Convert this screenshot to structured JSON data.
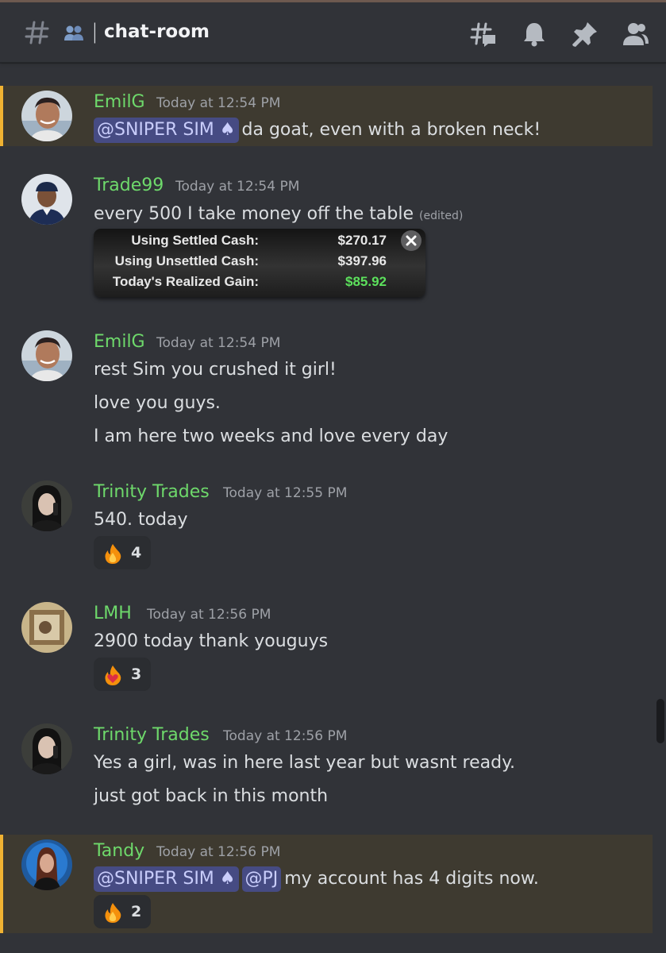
{
  "channel": {
    "name": "chat-room",
    "separator": "|",
    "icons": [
      "hash-icon",
      "members-icon",
      "threads-icon",
      "bell-icon",
      "pin-icon",
      "member-list-icon"
    ]
  },
  "mention_chip": "@SNIPER SIM ♠",
  "mention_chip_pj": "@PJ",
  "messages": [
    {
      "author": "EmilG",
      "timestamp": "Today at 12:54 PM",
      "highlighted": true,
      "text": "da goat, even with a broken neck!"
    },
    {
      "author": "Trade99",
      "timestamp": "Today at 12:54 PM",
      "text": "every 500 I take money off the table",
      "edited": "(edited)",
      "attachment": {
        "rows": [
          {
            "label": "Using Settled Cash:",
            "value": "$270.17"
          },
          {
            "label": "Using Unsettled Cash:",
            "value": "$397.96"
          },
          {
            "label": "Today's Realized Gain:",
            "value": "$85.92"
          }
        ],
        "close_icon": "close-icon"
      }
    },
    {
      "author": "EmilG",
      "timestamp": "Today at 12:54 PM",
      "lines": [
        "rest Sim you crushed it girl!",
        "love you guys.",
        "I am here two weeks and love every day"
      ]
    },
    {
      "author": "Trinity Trades",
      "timestamp": "Today at 12:55 PM",
      "text": "540. today",
      "reaction": {
        "emoji": "fire-icon",
        "count": "4"
      }
    },
    {
      "author": "LMH",
      "timestamp": "Today at 12:56 PM",
      "text": "2900 today thank youguys",
      "reaction": {
        "emoji": "fire-heart-icon",
        "count": "3"
      }
    },
    {
      "author": "Trinity Trades",
      "timestamp": "Today at 12:56 PM",
      "lines": [
        "Yes a girl, was in here last year but wasnt ready.",
        "just got back in this month"
      ]
    },
    {
      "author": "Tandy",
      "timestamp": "Today at 12:56 PM",
      "highlighted": true,
      "text": "my account has 4 digits now.",
      "reaction": {
        "emoji": "fire-icon",
        "count": "2"
      }
    }
  ],
  "colors": {
    "background": "#313338",
    "username": "#6ed96b",
    "mention_bg": "#3e3a30",
    "mention_bar": "#f0b232",
    "chip_bg": "#464b83",
    "gain_green": "#5ce05c"
  }
}
